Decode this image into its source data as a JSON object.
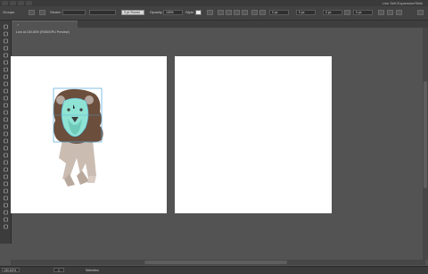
{
  "menubar": {
    "workspace": "Lion Self-Expansion/Shiki"
  },
  "controlbar": {
    "selection_label": "Groups",
    "stroke_label": "Stroke:",
    "stroke_profile": "3 pt. Round",
    "opacity_label": "Opacity:",
    "opacity_value": "100%",
    "style_label": "Style:",
    "x_value": "0 px",
    "y_value": "0 px",
    "w_value": "0 px",
    "h_value": "0 px"
  },
  "document": {
    "tab_title": "Lion at 150.83% (RGB/GPU Preview)"
  },
  "statusbar": {
    "zoom": "150.83%",
    "artboard_number": "1",
    "tool_name": "Selection"
  },
  "colors": {
    "mane": "#6b4e3b",
    "face": "#8fe3d4",
    "body": "#cbbcb1",
    "selection": "#53a7d9"
  },
  "tools": [
    "selection-icon",
    "direct-selection-icon",
    "magic-wand-icon",
    "lasso-icon",
    "pen-icon",
    "curvature-icon",
    "type-icon",
    "line-icon",
    "rectangle-icon",
    "paintbrush-icon",
    "pencil-icon",
    "shaper-icon",
    "eraser-icon",
    "rotate-icon",
    "scale-icon",
    "width-icon",
    "free-transform-icon",
    "shape-builder-icon",
    "perspective-icon",
    "mesh-icon",
    "gradient-icon",
    "eyedropper-icon",
    "blend-icon",
    "symbol-sprayer-icon",
    "column-graph-icon",
    "artboard-icon",
    "slice-icon",
    "hand-icon",
    "zoom-icon"
  ]
}
